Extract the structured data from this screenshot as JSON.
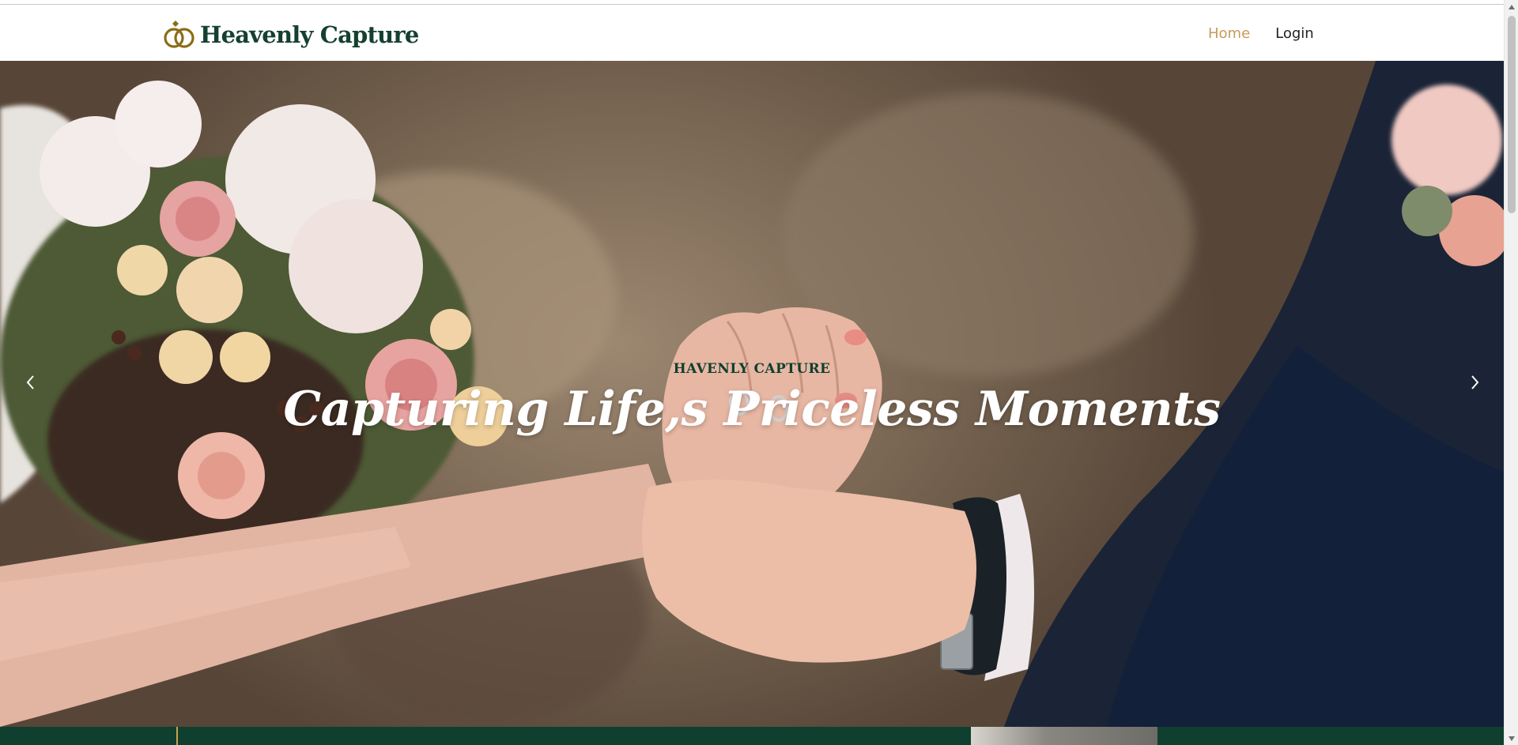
{
  "brand": {
    "name": "Heavenly Capture",
    "icon": "wedding-rings-icon"
  },
  "nav": {
    "home_label": "Home",
    "login_label": "Login",
    "active": "Home"
  },
  "hero": {
    "eyebrow": "HAVENLY CAPTURE",
    "heading": "Capturing Life,s Priceless Moments",
    "image": "bride-groom-hands-ring-photo",
    "prev_icon": "chevron-left-icon",
    "next_icon": "chevron-right-icon"
  },
  "colors": {
    "brand_green": "#154030",
    "nav_active": "#c79a5a",
    "nav_text": "#1d2125",
    "footer_strip": "#0f3f2e",
    "accent_gold": "#c7a24e"
  }
}
